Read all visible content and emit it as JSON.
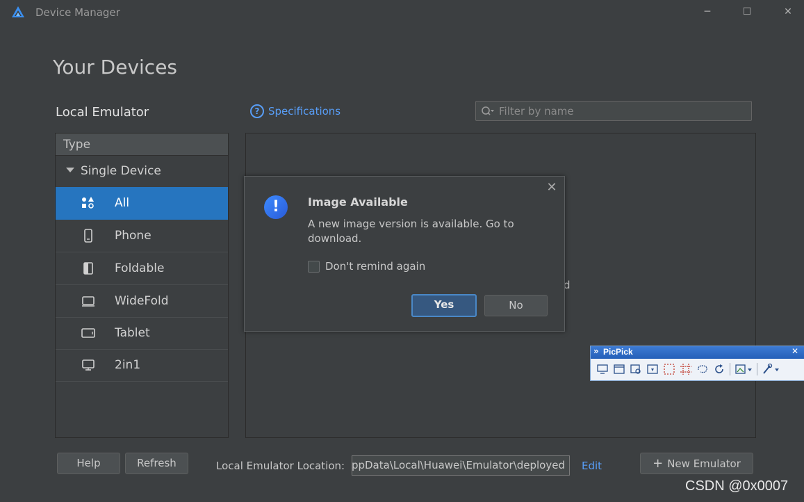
{
  "window": {
    "title": "Device Manager",
    "logo_icon": "harmony-logo-icon",
    "controls": [
      "minimize-icon",
      "maximize-icon",
      "close-icon"
    ]
  },
  "page": {
    "title": "Your Devices",
    "section_title": "Local Emulator",
    "specifications_label": "Specifications",
    "filter_placeholder": "Filter by name"
  },
  "sidebar": {
    "header": "Type",
    "group_label": "Single Device",
    "items": [
      {
        "label": "All",
        "icon": "apps-grid-icon",
        "selected": true
      },
      {
        "label": "Phone",
        "icon": "phone-icon",
        "selected": false
      },
      {
        "label": "Foldable",
        "icon": "foldable-icon",
        "selected": false
      },
      {
        "label": "WideFold",
        "icon": "widefold-icon",
        "selected": false
      },
      {
        "label": "Tablet",
        "icon": "tablet-icon",
        "selected": false
      },
      {
        "label": "2in1",
        "icon": "laptop-icon",
        "selected": false
      }
    ]
  },
  "content": {
    "partial_text": "d"
  },
  "dialog": {
    "title": "Image Available",
    "message": "A new image version is available. Go to download.",
    "checkbox_label": "Don't remind again",
    "yes_label": "Yes",
    "no_label": "No"
  },
  "picpick": {
    "title": "PicPick",
    "expand_glyph": "»",
    "close_glyph": "✕"
  },
  "footer": {
    "help_label": "Help",
    "refresh_label": "Refresh",
    "location_label": "Local Emulator Location:",
    "location_value": "ppData\\Local\\Huawei\\Emulator\\deployed",
    "edit_label": "Edit",
    "new_emulator_label": "New Emulator",
    "new_emulator_glyph": "+"
  },
  "watermark": "CSDN @0x0007",
  "colors": {
    "background": "#3c3f41",
    "accent": "#2675bf",
    "link": "#589df6"
  }
}
